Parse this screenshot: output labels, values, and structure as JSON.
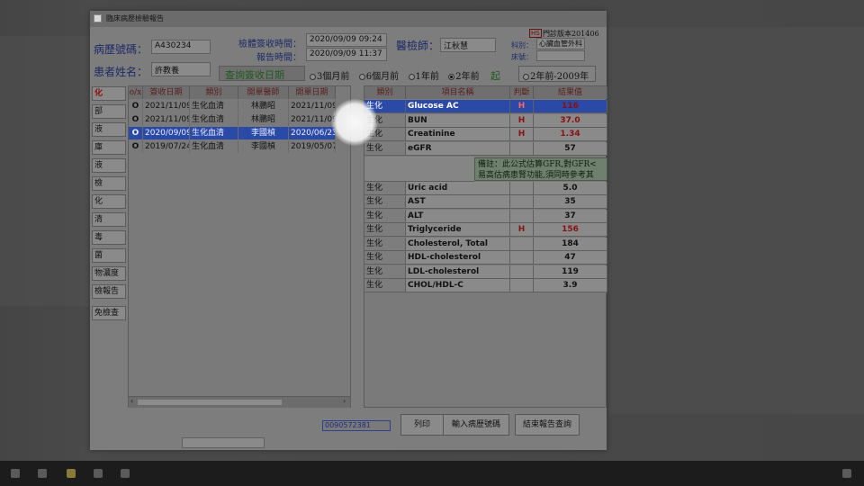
{
  "window": {
    "title": "臨床病歷檢驗報告"
  },
  "header": {
    "chart_no_label": "病歷號碼：",
    "chart_no": "A430234",
    "patient_label": "患者姓名：",
    "patient_name": "許教養",
    "received_label": "檢體簽收時間：",
    "received_time": "2020/09/09 09:24",
    "report_label": "報告時間：",
    "report_time": "2020/09/09 11:37",
    "physician_label": "醫檢師：",
    "physician": "江秋慧",
    "badge": "HS",
    "version": "門診版本201406",
    "dept_label": "科別：",
    "dept": "心臟血管外科",
    "bed_label": "床號："
  },
  "query": {
    "label": "查詢簽收日期",
    "options": [
      "3個月前",
      "6個月前",
      "1年前",
      "2年前"
    ],
    "selected": 3,
    "start_label": "起",
    "range_option": "2年前-2009年"
  },
  "sidebar": [
    "化",
    "部",
    "液",
    "庫",
    "液",
    "檢",
    "化",
    "清",
    "毒",
    "菌",
    "物濃度",
    "檢報告",
    "免檢查"
  ],
  "orders": {
    "columns": [
      "o/x",
      "簽收日期",
      "類別",
      "開單醫師",
      "開單日期"
    ],
    "rows": [
      {
        "ox": "O",
        "date": "2021/11/09",
        "type": "生化血清",
        "doctor": "林鵬昭",
        "order_date": "2021/11/09"
      },
      {
        "ox": "O",
        "date": "2021/11/09",
        "type": "生化血清",
        "doctor": "林鵬昭",
        "order_date": "2021/11/09"
      },
      {
        "ox": "O",
        "date": "2020/09/09",
        "type": "生化血清",
        "doctor": "李國楨",
        "order_date": "2020/06/23"
      },
      {
        "ox": "O",
        "date": "2019/07/24",
        "type": "生化血清",
        "doctor": "李國楨",
        "order_date": "2019/05/07"
      }
    ],
    "selected": 2
  },
  "results": {
    "columns": [
      "類別",
      "項目名稱",
      "判斷",
      "結果值"
    ],
    "rows": [
      {
        "cat": "生化",
        "name": "Glucose AC",
        "flag": "H",
        "value": "116"
      },
      {
        "cat": "生化",
        "name": "BUN",
        "flag": "H",
        "value": "37.0"
      },
      {
        "cat": "生化",
        "name": "Creatinine",
        "flag": "H",
        "value": "1.34"
      },
      {
        "cat": "生化",
        "name": "eGFR",
        "flag": "",
        "value": "57"
      },
      {
        "cat": "生化",
        "name": "Uric acid",
        "flag": "",
        "value": "5.0"
      },
      {
        "cat": "生化",
        "name": "AST",
        "flag": "",
        "value": "35"
      },
      {
        "cat": "生化",
        "name": "ALT",
        "flag": "",
        "value": "37"
      },
      {
        "cat": "生化",
        "name": "Triglyceride",
        "flag": "H",
        "value": "156"
      },
      {
        "cat": "生化",
        "name": "Cholesterol, Total",
        "flag": "",
        "value": "184"
      },
      {
        "cat": "生化",
        "name": "HDL-cholesterol",
        "flag": "",
        "value": "47"
      },
      {
        "cat": "生化",
        "name": "LDL-cholesterol",
        "flag": "",
        "value": "119"
      },
      {
        "cat": "生化",
        "name": "CHOL/HDL-C",
        "flag": "",
        "value": "3.9"
      }
    ],
    "note_line1": "備註：此公式估算GFR,對GFR<",
    "note_line2": "易高估病患腎功能,須同時參考其",
    "selected": 0
  },
  "footer": {
    "code": "0090572381",
    "print": "列印",
    "input_chart": "輸入病歷號碼",
    "end_query": "結束報告查詢"
  }
}
